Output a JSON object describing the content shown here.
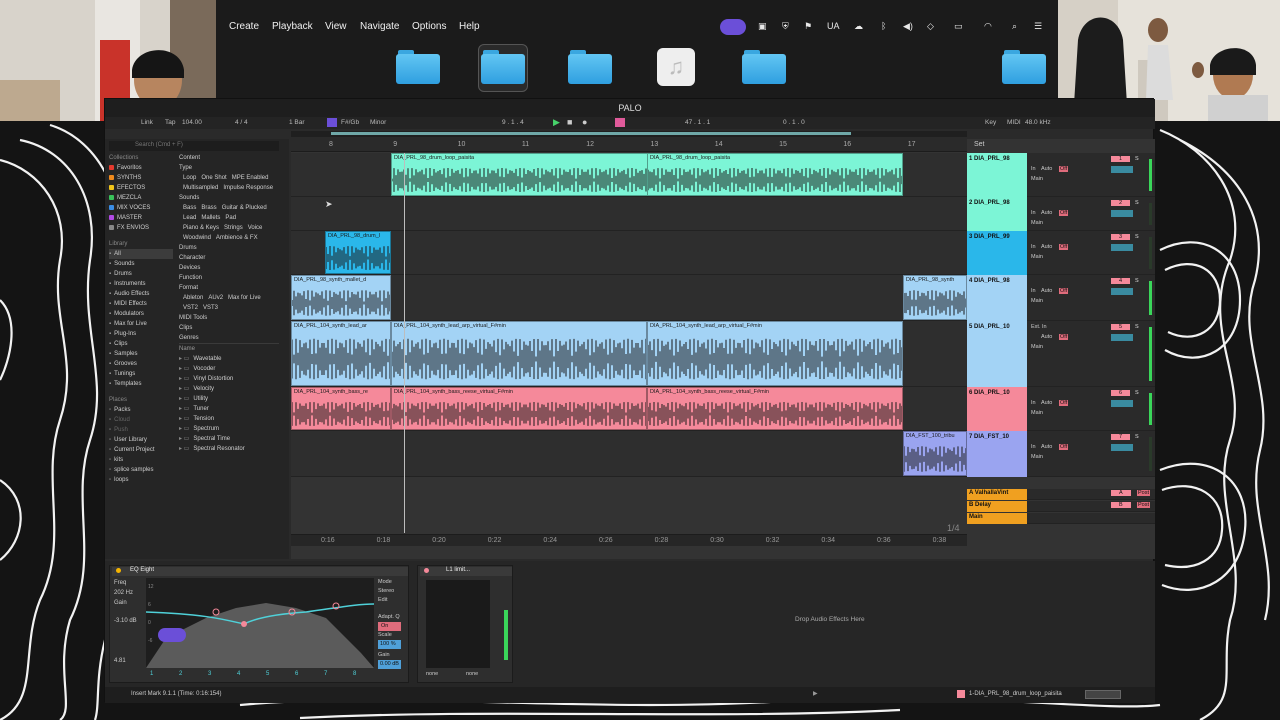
{
  "menubar": {
    "items": [
      "Create",
      "Playback",
      "View",
      "Navigate",
      "Options",
      "Help"
    ],
    "tray": {
      "lang": "UA"
    }
  },
  "daw": {
    "title": "PALO",
    "control_bar": {
      "link": "Link",
      "tap": "Tap",
      "tempo": "104.00",
      "sig": "4 / 4",
      "quant": "1 Bar",
      "key": "F#/Gb",
      "scale": "Minor",
      "position": "9 . 1 . 4",
      "end": "47 . 1 . 1",
      "loop_len": "0 . 1 . 0",
      "key_btn": "Key",
      "midi": "MIDI",
      "sample_rate": "48.0 kHz"
    },
    "browser": {
      "search_placeholder": "Search (Cmd + F)",
      "collections_header": "Collections",
      "collections": [
        {
          "label": "Favoritos",
          "color": "#e63a2e"
        },
        {
          "label": "SYNTHS",
          "color": "#f08a1c"
        },
        {
          "label": "EFECTOS",
          "color": "#f0c419"
        },
        {
          "label": "MEZCLA",
          "color": "#39c25a"
        },
        {
          "label": "MIX VOCES",
          "color": "#3a8de6"
        },
        {
          "label": "MASTER",
          "color": "#b24ae6"
        },
        {
          "label": "FX ENVIOS",
          "color": "#888888"
        }
      ],
      "library_header": "Library",
      "library": [
        "All",
        "Sounds",
        "Drums",
        "Instruments",
        "Audio Effects",
        "MIDI Effects",
        "Modulators",
        "Max for Live",
        "Plug-Ins",
        "Clips",
        "Samples",
        "Grooves",
        "Tunings",
        "Templates"
      ],
      "places_header": "Places",
      "places": [
        "Packs",
        "Cloud",
        "Push",
        "User Library",
        "Current Project",
        "kits",
        "splice samples",
        "loops"
      ],
      "filters": {
        "content": "Content",
        "type": "Type",
        "type_tags": [
          "Loop",
          "One Shot",
          "MPE Enabled",
          "Multisampled",
          "Impulse Response"
        ],
        "sounds": "Sounds",
        "sound_tags": [
          "Bass",
          "Brass",
          "Guitar & Plucked",
          "Lead",
          "Mallets",
          "Pad",
          "Piano & Keys",
          "Strings",
          "Voice",
          "Woodwind",
          "Ambience & FX"
        ],
        "drums": "Drums",
        "character": "Character",
        "devices": "Devices",
        "function": "Function",
        "format": "Format",
        "format_tags": [
          "Ableton",
          "AUv2",
          "Max for Live",
          "VST2",
          "VST3"
        ],
        "midi_tools": "MIDI Tools",
        "clips": "Clips",
        "genres": "Genres"
      },
      "name_header": "Name",
      "items": [
        "Wavetable",
        "Vocoder",
        "Vinyl Distortion",
        "Velocity",
        "Utility",
        "Tuner",
        "Tension",
        "Spectrum",
        "Spectral Time",
        "Spectral Resonator"
      ]
    },
    "ruler": [
      "8",
      "9",
      "10",
      "11",
      "12",
      "13",
      "14",
      "15",
      "16",
      "17"
    ],
    "time_ruler": [
      "0:16",
      "0:18",
      "0:20",
      "0:22",
      "0:24",
      "0:26",
      "0:28",
      "0:30",
      "0:32",
      "0:34",
      "0:36",
      "0:38"
    ],
    "page_indicator": "1/4",
    "set_label": "Set",
    "tracks": [
      {
        "name": "1 DIA_PRL_98",
        "color": "#7cf5d6",
        "num": "1"
      },
      {
        "name": "2 DIA_PRL_98",
        "color": "#7cf5d6",
        "num": "2"
      },
      {
        "name": "3 DIA_PRL_99",
        "color": "#2ab7ea",
        "num": "3"
      },
      {
        "name": "4 DIA_PRL_98",
        "color": "#a3d3f5",
        "num": "4"
      },
      {
        "name": "5 DIA_PRL_10",
        "color": "#a3d3f5",
        "num": "5"
      },
      {
        "name": "6 DIA_PRL_10",
        "color": "#f5899a",
        "num": "6"
      },
      {
        "name": "7 DIA_FST_10",
        "color": "#9aa4f0",
        "num": "7"
      }
    ],
    "returns": [
      {
        "name": "A ValhallaVint",
        "color": "#f0a020",
        "letter": "A"
      },
      {
        "name": "B Delay",
        "color": "#f0a020",
        "letter": "B"
      },
      {
        "name": "Main",
        "color": "#f0a020",
        "letter": ""
      }
    ],
    "clips": [
      {
        "name": "DIA_PRL_98_drum_loop_paisita",
        "lane": 0,
        "color": "#7cf5d6"
      },
      {
        "name": "DIA_PRL_98_drum_loop_paisita",
        "lane": 0,
        "color": "#7cf5d6"
      },
      {
        "name": "DIA_PRL_98_drum_l",
        "lane": 2,
        "color": "#2ab7ea"
      },
      {
        "name": "DIA_PRL_98_synth_mallet_d",
        "lane": 3,
        "color": "#a3d3f5"
      },
      {
        "name": "DIA_PRL_98_synth",
        "lane": 3,
        "color": "#a3d3f5"
      },
      {
        "name": "DIA_PRL_104_synth_lead_ar",
        "lane": 4,
        "color": "#a3d3f5"
      },
      {
        "name": "DIA_PRL_104_synth_lead_arp_virtual_F#min",
        "lane": 4,
        "color": "#a3d3f5"
      },
      {
        "name": "DIA_PRL_104_synth_lead_arp_virtual_F#min",
        "lane": 4,
        "color": "#a3d3f5"
      },
      {
        "name": "DIA_PRL_104_synth_bass_re",
        "lane": 5,
        "color": "#f5899a"
      },
      {
        "name": "DIA_PRL_104_synth_bass_reese_virtual_F#min",
        "lane": 5,
        "color": "#f5899a"
      },
      {
        "name": "DIA_PRL_104_synth_bass_reese_virtual_F#min",
        "lane": 5,
        "color": "#f5899a"
      },
      {
        "name": "DIA_FST_100_tribu",
        "lane": 6,
        "color": "#9aa4f0"
      }
    ],
    "mixer_labels": {
      "in": "In",
      "auto": "Auto",
      "off": "Off",
      "main": "Main",
      "ext": "Ext. In",
      "s": "S",
      "c": "C",
      "post": "Post",
      "split": "1/2"
    },
    "eq": {
      "title": "EQ Eight",
      "freq_label": "Freq",
      "freq": "202 Hz",
      "gain_label": "Gain",
      "gain": "-3.10 dB",
      "q": "4.81",
      "mode_label": "Mode",
      "mode": "Stereo",
      "edit": "Edit",
      "adapt": "Adapt. Q",
      "adapt_state": "On",
      "scale_label": "Scale",
      "scale": "100 %",
      "gain_out_label": "Gain",
      "gain_out": "0.00 dB",
      "bands": [
        "1",
        "2",
        "3",
        "4",
        "5",
        "6",
        "7",
        "8"
      ],
      "scale_ticks": [
        "12",
        "6",
        "0",
        "-6",
        "-12"
      ],
      "freq_ticks": [
        "100",
        "1k",
        "10k"
      ]
    },
    "limiter": {
      "title": "L1 limit...",
      "in": "none",
      "out": "none"
    },
    "drop_text": "Drop Audio Effects Here",
    "status_left": "Insert Mark 9.1.1 (Time: 0:16:154)",
    "status_right": "1-DIA_PRL_98_drum_loop_paisita",
    "zoom": "100x",
    "hw": "H W"
  }
}
